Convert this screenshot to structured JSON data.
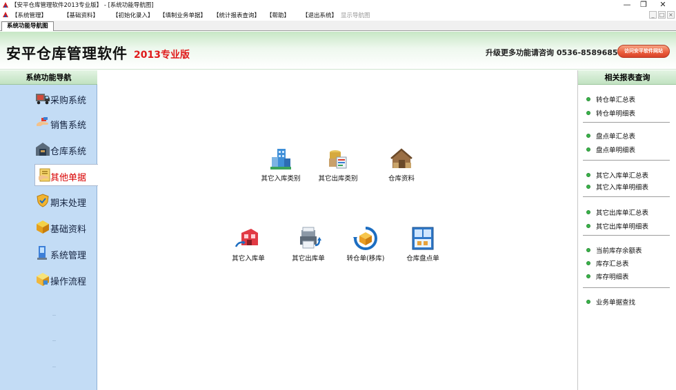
{
  "window": {
    "title": "【安平仓库管理软件2013专业版】 - [系统功能导航图]",
    "buttons": [
      "minimize",
      "restore",
      "close"
    ]
  },
  "menu": {
    "items": [
      "【系统管理】",
      "【基础资料】",
      "【初始化录入】",
      "【填制业务单据】",
      "【统计报表查询】",
      "【帮助】",
      "【退出系统】"
    ],
    "disabled_item": "显示导航图"
  },
  "tab": {
    "label": "系统功能导航图"
  },
  "banner": {
    "brand": "安平仓库管理软件",
    "edition": "2013专业版",
    "promo": "升级更多功能请咨询 0536-8589685",
    "visit_button": "访问安平软件网站"
  },
  "left_nav": {
    "header": "系统功能导航",
    "items": [
      {
        "label": "采购系统",
        "icon": "truck-icon"
      },
      {
        "label": "销售系统",
        "icon": "hand-icon"
      },
      {
        "label": "仓库系统",
        "icon": "warehouse-icon"
      },
      {
        "label": "其他单据",
        "icon": "document-icon",
        "active": true
      },
      {
        "label": "期末处理",
        "icon": "shield-icon"
      },
      {
        "label": "基础资料",
        "icon": "cube-icon"
      },
      {
        "label": "系统管理",
        "icon": "computer-icon"
      },
      {
        "label": "操作流程",
        "icon": "cube-flow-icon"
      }
    ]
  },
  "content": {
    "icons": [
      {
        "label": "其它入库类别",
        "icon": "building-category-icon"
      },
      {
        "label": "其它出库类别",
        "icon": "boxes-category-icon"
      },
      {
        "label": "仓库资料",
        "icon": "house-icon"
      },
      {
        "label": "其它入库单",
        "icon": "inbound-doc-icon"
      },
      {
        "label": "其它出库单",
        "icon": "outbound-doc-icon"
      },
      {
        "label": "转仓单(移库)",
        "icon": "transfer-icon"
      },
      {
        "label": "仓库盘点单",
        "icon": "inventory-check-icon"
      }
    ]
  },
  "right_panel": {
    "header": "相关报表查询",
    "groups": [
      [
        "转仓单汇总表",
        "转仓单明细表"
      ],
      [
        "盘点单汇总表",
        "盘点单明细表"
      ],
      [
        "其它入库单汇总表",
        "其它入库单明细表"
      ],
      [
        "其它出库单汇总表",
        "其它出库单明细表"
      ],
      [
        "当前库存余额表",
        "库存汇总表",
        "库存明细表"
      ],
      [
        "业务单据查找"
      ]
    ]
  },
  "colors": {
    "accent_red": "#e01b1b",
    "nav_bg": "#c3dcf5",
    "header_green": "#c1e2c1",
    "bullet_green": "#39b54a"
  }
}
